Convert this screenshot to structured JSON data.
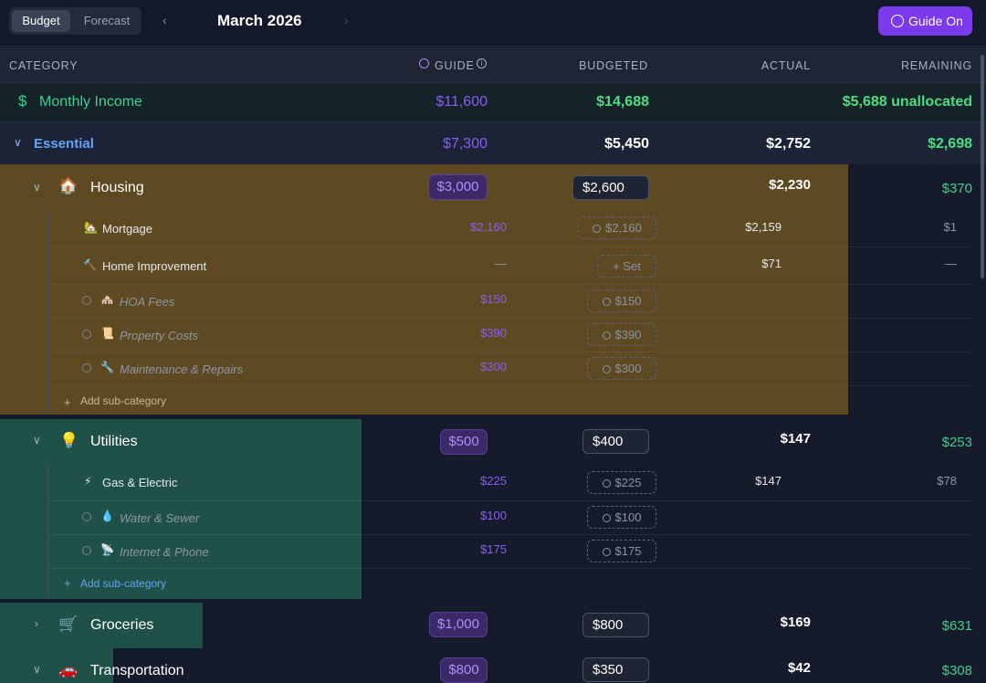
{
  "topbar": {
    "tab_budget": "Budget",
    "tab_forecast": "Forecast",
    "prev": "‹",
    "next": "›",
    "month": "March 2026",
    "guide_button": "Guide On"
  },
  "columns": {
    "category": "CATEGORY",
    "guide": "GUIDE",
    "budgeted": "BUDGETED",
    "actual": "ACTUAL",
    "remaining": "REMAINING"
  },
  "income": {
    "icon": "$",
    "label": "Monthly Income",
    "guide": "$11,600",
    "budgeted": "$14,688",
    "remaining": "$5,688 unallocated"
  },
  "essential": {
    "label": "Essential",
    "guide": "$7,300",
    "budgeted": "$5,450",
    "actual": "$2,752",
    "remaining": "$2,698"
  },
  "housing": {
    "icon": "🏠",
    "label": "Housing",
    "guide": "$3,000",
    "budgeted": "$2,600",
    "actual": "$2,230",
    "remaining": "$370",
    "subs": [
      {
        "icon": "🏡",
        "label": "Mortgage",
        "guide": "$2,160",
        "budgeted": "$2,160",
        "actual": "$2,159",
        "remaining": "$1"
      },
      {
        "icon": "🔨",
        "label": "Home Improvement",
        "guide": "—",
        "budgeted": "Set",
        "actual": "$71",
        "remaining": "—"
      },
      {
        "icon": "🏘️",
        "label": "HOA Fees",
        "guide": "$150",
        "budgeted": "$150"
      },
      {
        "icon": "📜",
        "label": "Property Costs",
        "guide": "$390",
        "budgeted": "$390"
      },
      {
        "icon": "🔧",
        "label": "Maintenance & Repairs",
        "guide": "$300",
        "budgeted": "$300"
      }
    ],
    "add": "Add sub-category"
  },
  "utilities": {
    "icon": "💡",
    "label": "Utilities",
    "guide": "$500",
    "budgeted": "$400",
    "actual": "$147",
    "remaining": "$253",
    "subs": [
      {
        "icon": "⚡",
        "label": "Gas & Electric",
        "guide": "$225",
        "budgeted": "$225",
        "actual": "$147",
        "remaining": "$78"
      },
      {
        "icon": "💧",
        "label": "Water & Sewer",
        "guide": "$100",
        "budgeted": "$100"
      },
      {
        "icon": "📡",
        "label": "Internet & Phone",
        "guide": "$175",
        "budgeted": "$175"
      }
    ],
    "add": "Add sub-category"
  },
  "groceries": {
    "icon": "🛒",
    "label": "Groceries",
    "guide": "$1,000",
    "budgeted": "$800",
    "actual": "$169",
    "remaining": "$631"
  },
  "transportation": {
    "icon": "🚗",
    "label": "Transportation",
    "guide": "$800",
    "budgeted": "$350",
    "actual": "$42",
    "remaining": "$308"
  },
  "colors": {
    "accent": "#7c3aed",
    "income_green": "#3ecf8e",
    "essential_blue": "#60a5fa",
    "guide_purple": "#8b5cf6"
  }
}
